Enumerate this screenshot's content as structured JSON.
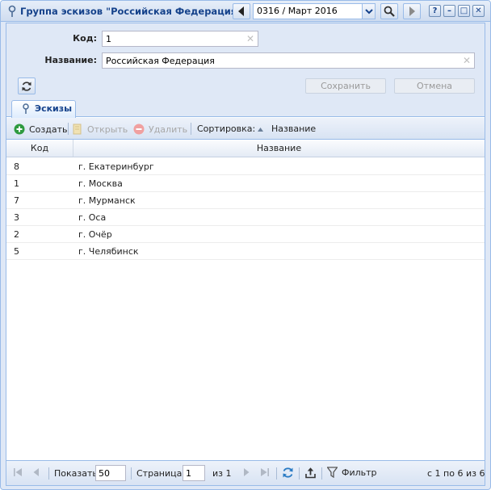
{
  "window": {
    "title": "Группа эскизов \"Российская Федерация\"",
    "period": "0316 / Март 2016",
    "help_label": "?",
    "minimize_label": "–",
    "maximize_label": "□",
    "close_label": "✕"
  },
  "form": {
    "code_label": "Код:",
    "code_value": "1",
    "name_label": "Название:",
    "name_value": "Российская Федерация",
    "save_label": "Сохранить",
    "cancel_label": "Отмена"
  },
  "tabs": [
    {
      "label": "Эскизы"
    }
  ],
  "toolbar": {
    "create_label": "Создать",
    "open_label": "Открыть",
    "delete_label": "Удалить",
    "sort_label": "Сортировка:",
    "sort_field": "Название"
  },
  "grid": {
    "columns": [
      "Код",
      "Название"
    ],
    "rows": [
      {
        "code": "8",
        "name": "г. Екатеринбург"
      },
      {
        "code": "1",
        "name": "г. Москва"
      },
      {
        "code": "7",
        "name": "г. Мурманск"
      },
      {
        "code": "3",
        "name": "г. Оса"
      },
      {
        "code": "2",
        "name": "г. Очёр"
      },
      {
        "code": "5",
        "name": "г. Челябинск"
      }
    ]
  },
  "pager": {
    "show_label": "Показать",
    "page_size": "50",
    "page_label": "Страница",
    "page_value": "1",
    "of_pages": "из 1",
    "filter_label": "Фильтр",
    "range_text": "с 1 по 6 из 6"
  },
  "colors": {
    "accent": "#15428b",
    "border": "#99bbe8",
    "create_green": "#2e9a3f"
  }
}
